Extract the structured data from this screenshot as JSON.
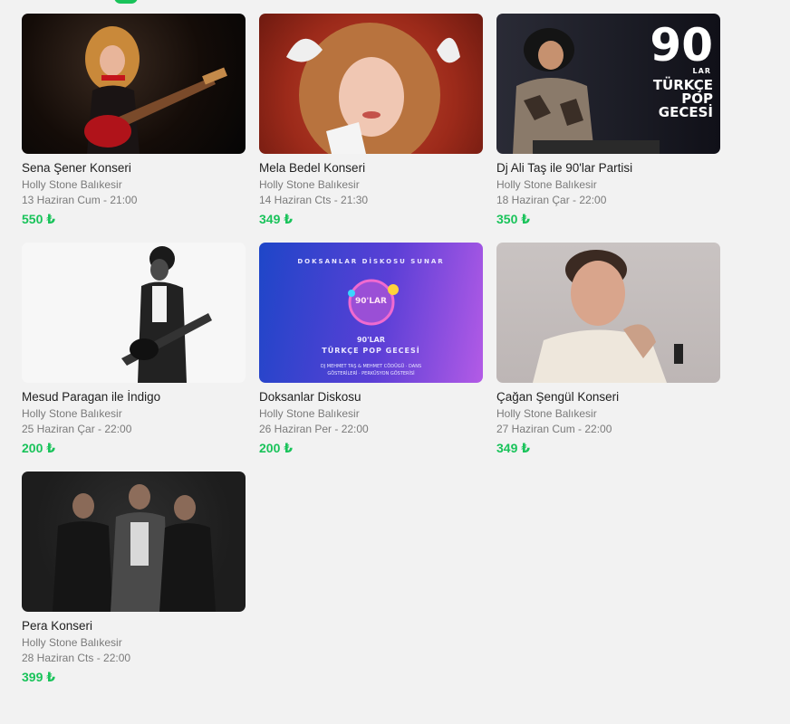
{
  "events": [
    {
      "title": "Sena Şener Konseri",
      "venue": "Holly Stone Balıkesir",
      "date": "13 Haziran Cum - 21:00",
      "price": "550 ₺"
    },
    {
      "title": "Mela Bedel Konseri",
      "venue": "Holly Stone Balıkesir",
      "date": "14 Haziran Cts - 21:30",
      "price": "349 ₺"
    },
    {
      "title": "Dj Ali Taş ile 90'lar Partisi",
      "venue": "Holly Stone Balıkesir",
      "date": "18 Haziran Çar - 22:00",
      "price": "350 ₺",
      "art": {
        "big": "90",
        "small": "LAR",
        "l1": "TÜRKÇE",
        "l2": "POP",
        "l3": "GECESİ"
      }
    },
    {
      "title": "Mesud Paragan ile İndigo",
      "venue": "Holly Stone Balıkesir",
      "date": "25 Haziran Çar - 22:00",
      "price": "200 ₺"
    },
    {
      "title": "Doksanlar Diskosu",
      "venue": "Holly Stone Balıkesir",
      "date": "26 Haziran Per - 22:00",
      "price": "200 ₺",
      "art": {
        "header": "DOKSANLAR DİSKOSU SUNAR",
        "badge": "90'LAR",
        "l1": "90'LAR",
        "l2": "TÜRKÇE POP GECESİ",
        "small1": "DJ MEHMET TAŞ & MEHMET CÖDÜGÜ · DANS",
        "small2": "GÖSTERİLERİ · PERKÜSYON GÖSTERİSİ"
      }
    },
    {
      "title": "Çağan Şengül Konseri",
      "venue": "Holly Stone Balıkesir",
      "date": "27 Haziran Cum - 22:00",
      "price": "349 ₺"
    },
    {
      "title": "Pera Konseri",
      "venue": "Holly Stone Balıkesir",
      "date": "28 Haziran Cts - 22:00",
      "price": "399 ₺"
    }
  ],
  "colors": {
    "accent": "#19c35a",
    "background": "#f2f2f2"
  }
}
